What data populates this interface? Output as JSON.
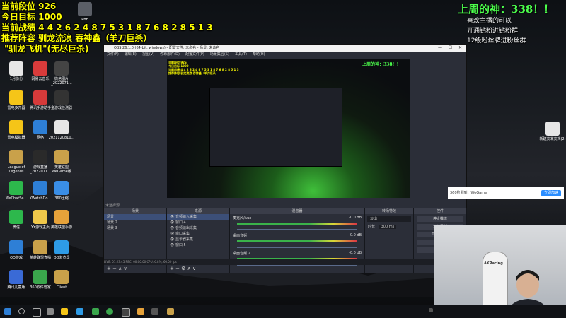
{
  "overlay_left": {
    "line1": "当前段位 926",
    "line2": "今日目标 1000",
    "line3": "当前战绩 4 4 2 6 2 4 8 7 5 3 1 8 7 6 8 2 8 5 1 3",
    "line4": "推荐阵容 驯龙流浪 吞神鑫（羊刀巨杀）",
    "line5": "\"驯龙飞机\"(无尽巨杀)"
  },
  "overlay_right": {
    "title": "上周的神：338！！",
    "line1": "喜欢主播的可以",
    "line2": "开通钻粉进钻粉群",
    "line3": "12级粉丝牌进粉丝群"
  },
  "desktop_icons": [
    {
      "label": "PBE",
      "color": "#5b5f67"
    },
    {
      "label": "1月份份",
      "color": "#e6e6e6"
    },
    {
      "label": "网易云音乐",
      "color": "#d93b3b"
    },
    {
      "label": "微信图片_2022071...",
      "color": "#444"
    },
    {
      "label": "雷电多开器",
      "color": "#f5c518"
    },
    {
      "label": "腾讯手游助手",
      "color": "#d63a3a"
    },
    {
      "label": "金游戏检测器",
      "color": "#333"
    },
    {
      "label": "雷电模拟器",
      "color": "#f5c518"
    },
    {
      "label": "网络",
      "color": "#2e7fd6"
    },
    {
      "label": "2021120810...",
      "color": "#e6e6e6"
    },
    {
      "label": "League of Legends",
      "color": "#c9a14a"
    },
    {
      "label": "游戏直播_2022071...",
      "color": "#2a2a2a"
    },
    {
      "label": "英雄联盟WeGame版",
      "color": "#c9a14a"
    },
    {
      "label": "WeChatSe...",
      "color": "#2db84c"
    },
    {
      "label": "KWatchDo...",
      "color": "#2e7fd6"
    },
    {
      "label": "360压缩",
      "color": "#3a8ee6"
    },
    {
      "label": "微信",
      "color": "#2db84c"
    },
    {
      "label": "YY游戏主页",
      "color": "#f0c84a"
    },
    {
      "label": "英雄联盟手游",
      "color": "#e6a23a"
    },
    {
      "label": "QQ游戏",
      "color": "#2e7fd6"
    },
    {
      "label": "英雄联盟直播",
      "color": "#c9a14a"
    },
    {
      "label": "QQ浏览器",
      "color": "#2e9be6"
    },
    {
      "label": "腾讯儿童版",
      "color": "#3a6ad6"
    },
    {
      "label": "360软件管家",
      "color": "#3aa64c"
    },
    {
      "label": "Client",
      "color": "#c9a14a"
    },
    {
      "label": "新建文本文档(2)",
      "color": "#e6e6e6"
    }
  ],
  "obs": {
    "title": "OBS 26.1.0 (64-bit, windows) - 配置文件: 未命名 - 场景: 未命名",
    "menu": [
      "文件(F)",
      "编辑(E)",
      "视图(V)",
      "停靠部件(D)",
      "配置文件(P)",
      "场景集合(S)",
      "工具(T)",
      "帮助(H)"
    ],
    "no_source": "未选择源",
    "panels": {
      "scenes": "场景",
      "sources": "来源",
      "mixer": "混音器",
      "transitions": "转场特效",
      "controls": "控件"
    },
    "scene_items": [
      "场景",
      "场景 2",
      "场景 3"
    ],
    "source_items": [
      "音频输入采集",
      "窗口 4",
      "音频输出采集",
      "窗口采集",
      "显示器采集",
      "窗口 5"
    ],
    "mixer_items": [
      "麦克风/Aux",
      "桌面音频",
      "桌面音频 2"
    ],
    "mixer_db": [
      "-0.0 dB",
      "-0.0 dB",
      "-0.0 dB"
    ],
    "transition": "淡出",
    "transition_duration_label": "时长",
    "transition_duration": "300 ms",
    "controls": [
      "停止推流",
      "开始录制",
      "工作室模式",
      "设置",
      "退出"
    ],
    "status": "LIVE: 01:23:45  REC: 00:00:00  CPU: 6.8%, 60.00 fps"
  },
  "notification": {
    "text": "360检测到：WeGame",
    "button": "立即加速"
  },
  "webcam": {
    "chair_brand": "AKRacing"
  },
  "colors": {
    "overlay_yellow": "#ffff00",
    "overlay_green": "#4cff4c",
    "obs_bg": "#2b2e38",
    "accent_blue": "#2a8dff"
  }
}
